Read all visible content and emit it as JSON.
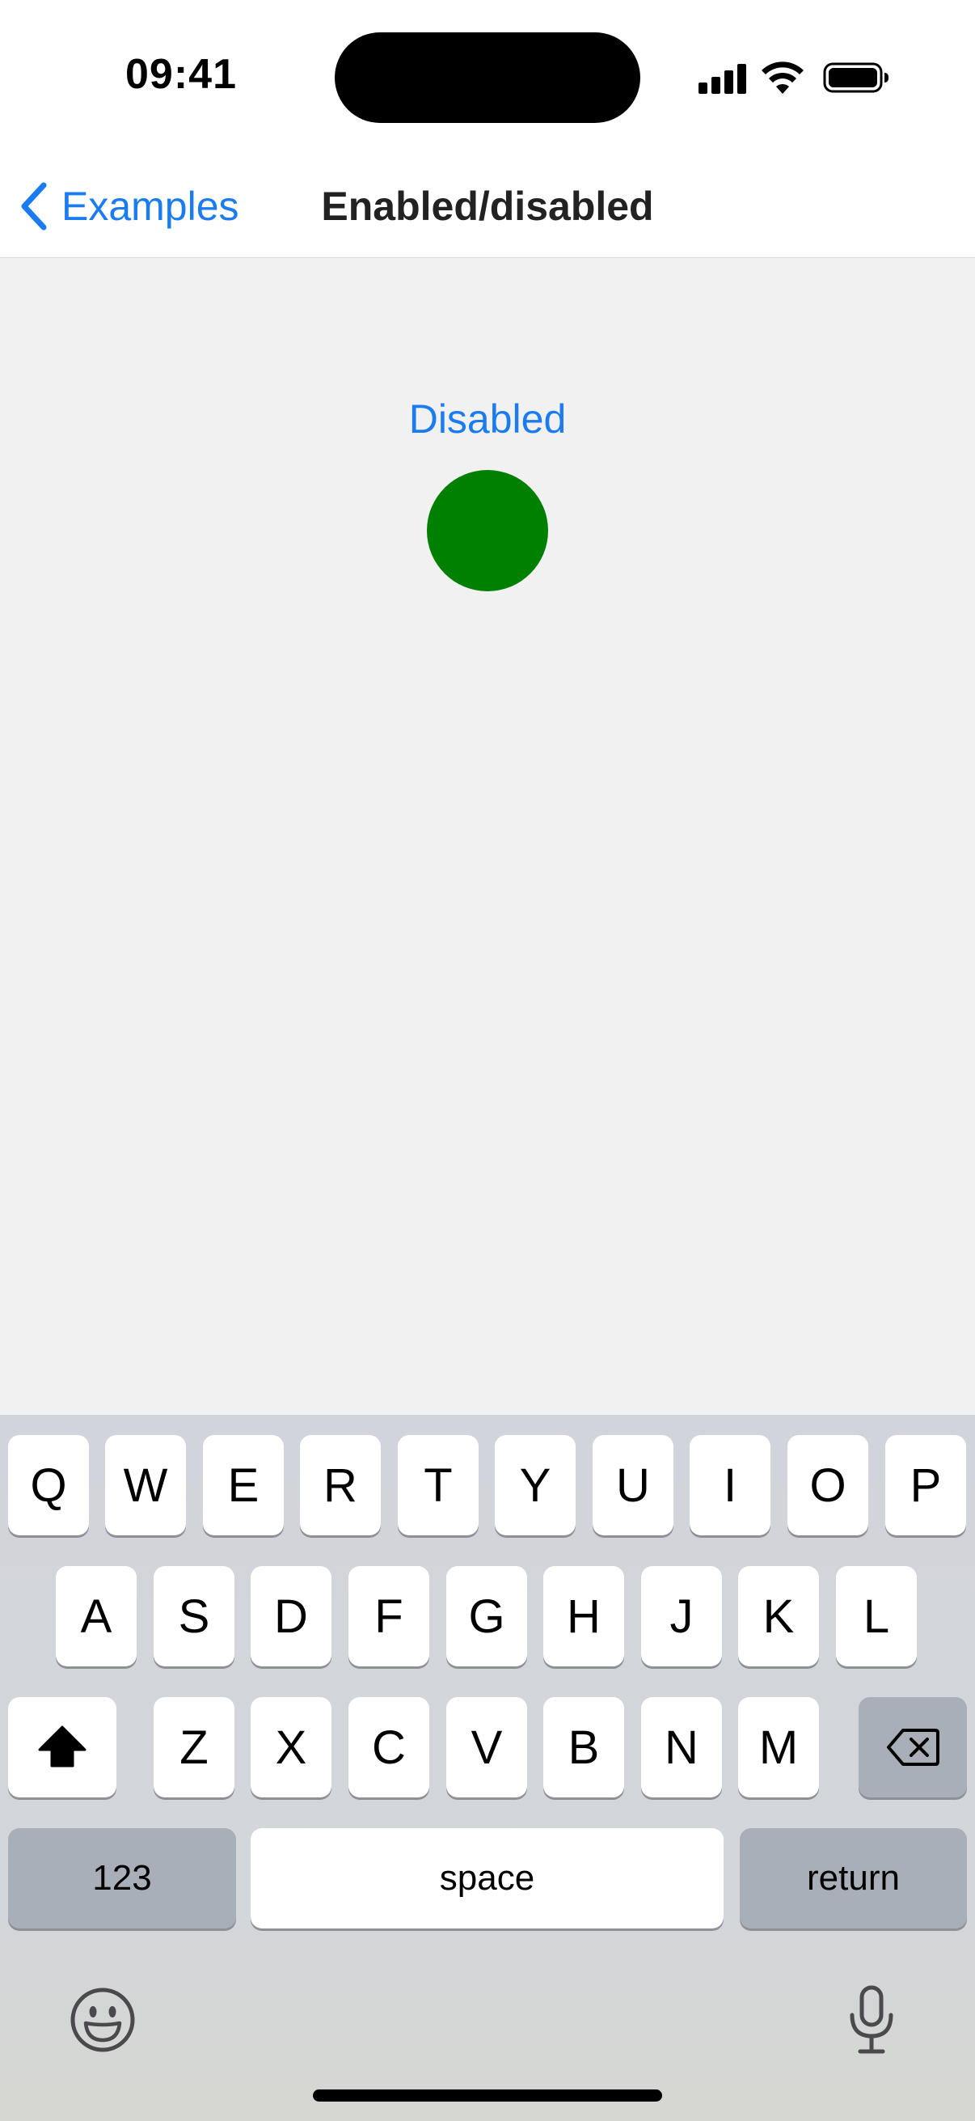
{
  "status_bar": {
    "time": "09:41"
  },
  "nav": {
    "back_label": "Examples",
    "title": "Enabled/disabled"
  },
  "content": {
    "toggle_label": "Disabled",
    "circle_color": "#008000"
  },
  "keyboard": {
    "row1": [
      "Q",
      "W",
      "E",
      "R",
      "T",
      "Y",
      "U",
      "I",
      "O",
      "P"
    ],
    "row2": [
      "A",
      "S",
      "D",
      "F",
      "G",
      "H",
      "J",
      "K",
      "L"
    ],
    "row3": [
      "Z",
      "X",
      "C",
      "V",
      "B",
      "N",
      "M"
    ],
    "numbers_label": "123",
    "space_label": "space",
    "return_label": "return"
  },
  "colors": {
    "accent": "#1a7cf0",
    "background": "#f1f1f1",
    "keyboard_background": "#d1d4da"
  }
}
